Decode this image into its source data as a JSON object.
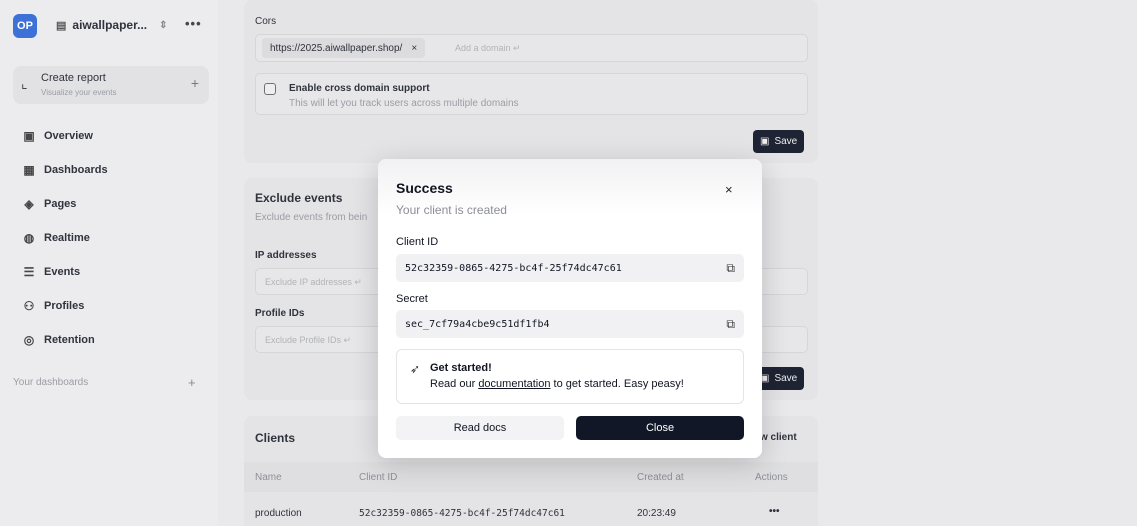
{
  "sidebar": {
    "brand": "OP",
    "project_name": "aiwallpaper...",
    "more": "•••",
    "create_report": {
      "title": "Create report",
      "subtitle": "Visualize your events",
      "plus": "+"
    },
    "items": [
      {
        "label": "Overview",
        "icon": "overview-icon"
      },
      {
        "label": "Dashboards",
        "icon": "dashboards-icon"
      },
      {
        "label": "Pages",
        "icon": "pages-icon"
      },
      {
        "label": "Realtime",
        "icon": "realtime-icon"
      },
      {
        "label": "Events",
        "icon": "events-icon"
      },
      {
        "label": "Profiles",
        "icon": "profiles-icon"
      },
      {
        "label": "Retention",
        "icon": "retention-icon"
      }
    ],
    "your_dashboards": "Your dashboards",
    "dashboards_plus": "+"
  },
  "cors": {
    "label": "Cors",
    "domain_tag": "https://2025.aiwallpaper.shop/",
    "domain_remove": "×",
    "add_placeholder": "Add a domain ↵",
    "cross_domain_label": "Enable cross domain support",
    "cross_domain_desc": "This will let you track users across multiple domains",
    "save_label": "Save"
  },
  "exclude": {
    "title": "Exclude events",
    "subtitle": "Exclude events from bein",
    "ip_label": "IP addresses",
    "ip_placeholder": "Exclude IP addresses ↵",
    "profile_label": "Profile IDs",
    "profile_placeholder": "Exclude Profile IDs ↵",
    "save_label": "Save"
  },
  "clients": {
    "title": "Clients",
    "new_client": "w client",
    "columns": [
      "Name",
      "Client ID",
      "Created at",
      "Actions"
    ],
    "rows": [
      {
        "name": "production",
        "client_id": "52c32359-0865-4275-bc4f-25f74dc47c61",
        "created_at": "20:23:49",
        "actions": "•••"
      }
    ]
  },
  "modal": {
    "title": "Success",
    "subtitle": "Your client is created",
    "close_icon": "×",
    "client_id_label": "Client ID",
    "client_id_value": "52c32359-0865-4275-bc4f-25f74dc47c61",
    "secret_label": "Secret",
    "secret_value": "sec_7cf79a4cbe9c51df1fb4",
    "tip_title": "Get started!",
    "tip_prefix": "Read our ",
    "tip_link": "documentation",
    "tip_suffix": " to get started. Easy peasy!",
    "read_docs": "Read docs",
    "close": "Close"
  }
}
